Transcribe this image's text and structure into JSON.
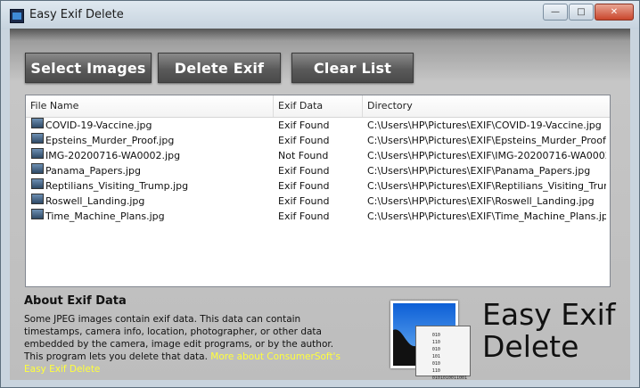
{
  "window": {
    "title": "Easy Exif Delete"
  },
  "toolbar": {
    "select_images": "Select Images",
    "delete_exif": "Delete Exif",
    "clear_list": "Clear List"
  },
  "columns": [
    "File Name",
    "Exif Data",
    "Directory"
  ],
  "rows": [
    {
      "name": "COVID-19-Vaccine.jpg",
      "exif": "Exif Found",
      "dir": "C:\\Users\\HP\\Pictures\\EXIF\\COVID-19-Vaccine.jpg"
    },
    {
      "name": "Epsteins_Murder_Proof.jpg",
      "exif": "Exif Found",
      "dir": "C:\\Users\\HP\\Pictures\\EXIF\\Epsteins_Murder_Proof.jpg"
    },
    {
      "name": "IMG-20200716-WA0002.jpg",
      "exif": "Not Found",
      "dir": "C:\\Users\\HP\\Pictures\\EXIF\\IMG-20200716-WA0002..."
    },
    {
      "name": "Panama_Papers.jpg",
      "exif": "Exif Found",
      "dir": "C:\\Users\\HP\\Pictures\\EXIF\\Panama_Papers.jpg"
    },
    {
      "name": "Reptilians_Visiting_Trump.jpg",
      "exif": "Exif Found",
      "dir": "C:\\Users\\HP\\Pictures\\EXIF\\Reptilians_Visiting_Trum..."
    },
    {
      "name": "Roswell_Landing.jpg",
      "exif": "Exif Found",
      "dir": "C:\\Users\\HP\\Pictures\\EXIF\\Roswell_Landing.jpg"
    },
    {
      "name": "Time_Machine_Plans.jpg",
      "exif": "Exif Found",
      "dir": "C:\\Users\\HP\\Pictures\\EXIF\\Time_Machine_Plans.jpg"
    }
  ],
  "about": {
    "title": "About Exif Data",
    "text": "Some JPEG images contain exif data. This data can contain timestamps, camera info, location, photographer, or other data embedded by the camera, image edit programs, or by the author. This program lets you delete that data.",
    "link": "More about ConsumerSoft's Easy Exif Delete"
  },
  "logo": {
    "line1": "Easy Exif",
    "line2": "Delete",
    "bits": "010\n110\n010\n101\n010\n110\n0101010011001"
  },
  "colors": {
    "link": "#ffff3a",
    "button": "#5a5a5a"
  }
}
